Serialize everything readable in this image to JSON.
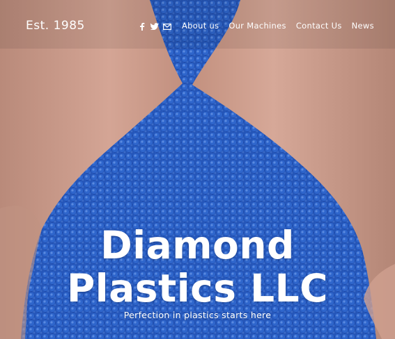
{
  "header": {
    "brand_text": "Est. 1985",
    "social_icons": [
      "facebook-icon",
      "twitter-icon",
      "mail-icon"
    ],
    "nav": [
      "About us",
      "Our Machines",
      "Contact Us",
      "News"
    ]
  },
  "hero": {
    "title_line1": "Diamond",
    "title_line2": "Plastics LLC",
    "tagline": "Perfection in plastics starts here"
  },
  "colors": {
    "pellet_blue": "#2456b8",
    "skin_tone": "#c99a88",
    "text": "#ffffff"
  }
}
